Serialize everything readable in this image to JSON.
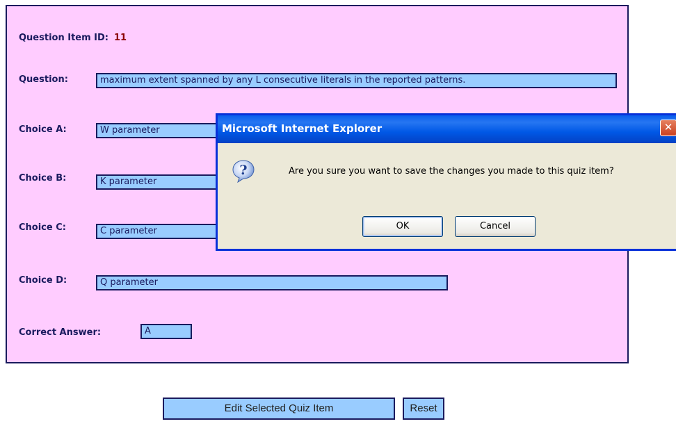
{
  "form": {
    "item_id_label": "Question Item ID:",
    "item_id_value": "11",
    "question_label": "Question:",
    "question_value": "maximum extent spanned by any L consecutive literals in the reported patterns.",
    "choice_a_label": "Choice A:",
    "choice_a_value": "W parameter",
    "choice_b_label": "Choice B:",
    "choice_b_value": "K parameter",
    "choice_c_label": "Choice C:",
    "choice_c_value": "C parameter",
    "choice_d_label": "Choice D:",
    "choice_d_value": "Q parameter",
    "correct_answer_label": "Correct Answer:",
    "correct_answer_value": "A"
  },
  "buttons": {
    "edit_label": "Edit Selected Quiz Item",
    "reset_label": "Reset"
  },
  "dialog": {
    "title": "Microsoft Internet Explorer",
    "close_glyph": "✕",
    "icon": "question-icon",
    "icon_glyph": "?",
    "message": "Are you sure you want to save the changes you made to this quiz item?",
    "ok_label": "OK",
    "cancel_label": "Cancel"
  },
  "colors": {
    "panel_background": "#ffccff",
    "field_background": "#99ccff",
    "label_color": "#1a1a5e",
    "item_id_color": "#8b0000",
    "dialog_title_blue": "#0058e6"
  }
}
